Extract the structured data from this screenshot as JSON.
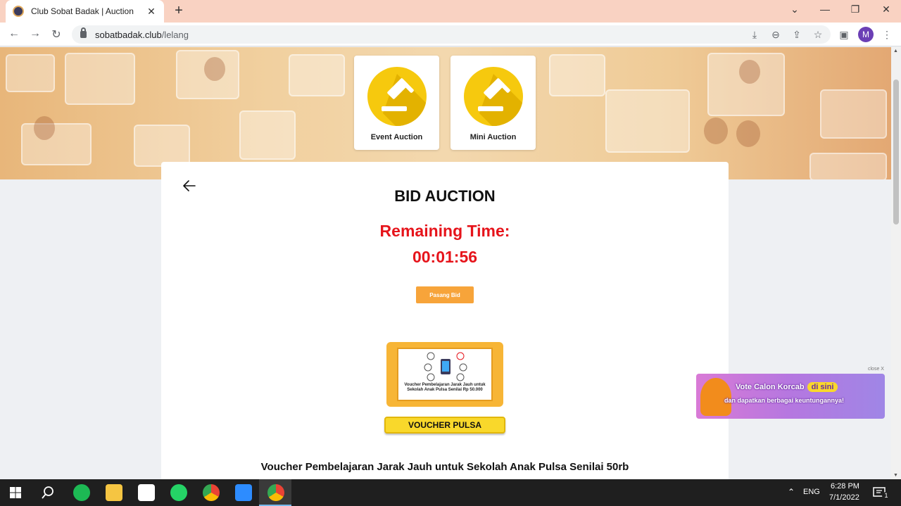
{
  "browser": {
    "tab_title": "Club Sobat Badak | Auction",
    "tab_close": "✕",
    "new_tab": "+",
    "url_host": "sobatbadak.club",
    "url_path": "/lelang",
    "profile_initial": "M",
    "window_controls": {
      "chevron": "⌄",
      "minimize": "—",
      "restore": "❐",
      "close": "✕"
    }
  },
  "categories": [
    {
      "label": "Event Auction"
    },
    {
      "label": "Mini Auction"
    }
  ],
  "auction": {
    "title": "BID AUCTION",
    "remaining_label": "Remaining Time:",
    "countdown": "00:01:56",
    "bid_button": "Pasang Bid",
    "voucher_caption": "Voucher Pembelajaran Jarak Jauh untuk Sekolah Anak Pulsa Senilai Rp 50.000",
    "voucher_tag": "VOUCHER PULSA",
    "product_name": "Voucher Pembelajaran Jarak Jauh untuk Sekolah Anak Pulsa Senilai 50rb"
  },
  "ad": {
    "close_label": "close X",
    "line1": "Vote Calon Korcab",
    "pill": "di sini",
    "line2": "dan dapatkan berbagai keuntungannya!"
  },
  "taskbar": {
    "language": "ENG",
    "time": "6:28 PM",
    "date": "7/1/2022",
    "notification_count": "1"
  },
  "colors": {
    "accent_red": "#e6141b",
    "bid_orange": "#f7a43a",
    "gavel_yellow": "#f6c90e",
    "tabbar_peach": "#f9d2c2"
  }
}
